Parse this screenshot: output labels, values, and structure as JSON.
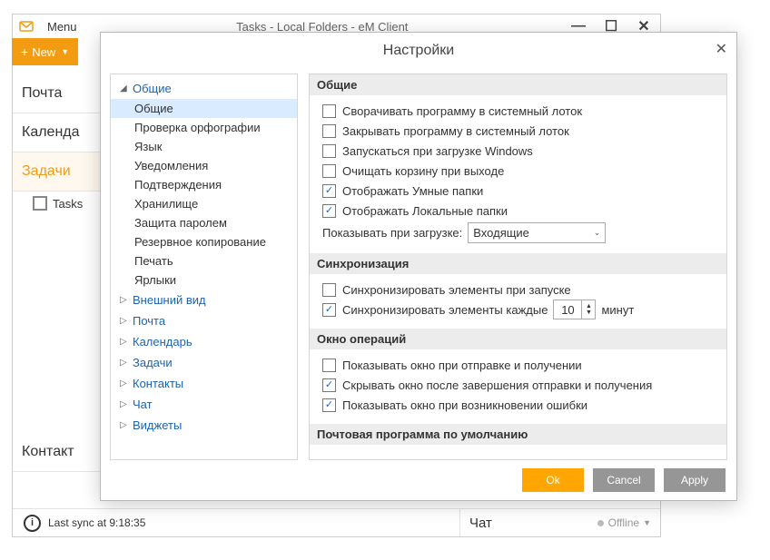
{
  "main": {
    "menu_label": "Menu",
    "title": "Tasks - Local Folders - eM Client",
    "new_button": "New",
    "nav": {
      "mail": "Почта",
      "calendar": "Календа",
      "tasks": "Задачи",
      "contacts": "Контакт",
      "tasks_sub": "Tasks"
    }
  },
  "status": {
    "last_sync": "Last sync at 9:18:35",
    "chat_label": "Чат",
    "offline": "Offline"
  },
  "dialog": {
    "title": "Настройки",
    "tree": {
      "general": "Общие",
      "general_children": {
        "general": "Общие",
        "spellcheck": "Проверка орфографии",
        "language": "Язык",
        "notifications": "Уведомления",
        "confirmations": "Подтверждения",
        "storage": "Хранилище",
        "password": "Защита паролем",
        "backup": "Резервное копирование",
        "print": "Печать",
        "shortcuts": "Ярлыки"
      },
      "appearance": "Внешний вид",
      "mail": "Почта",
      "calendar": "Календарь",
      "tasks": "Задачи",
      "contacts": "Контакты",
      "chat": "Чат",
      "widgets": "Виджеты"
    },
    "sections": {
      "general_header": "Общие",
      "general_opts": {
        "minimize_tray": "Сворачивать программу в системный лоток",
        "close_tray": "Закрывать программу в системный лоток",
        "run_startup": "Запускаться при загрузке Windows",
        "empty_trash": "Очищать корзину при выходе",
        "smart_folders": "Отображать Умные папки",
        "local_folders": "Отображать Локальные папки",
        "show_on_start_label": "Показывать при загрузке:",
        "show_on_start_value": "Входящие"
      },
      "sync_header": "Синхронизация",
      "sync_opts": {
        "sync_startup": "Синхронизировать элементы при запуске",
        "sync_every": "Синхронизировать элементы каждые",
        "sync_minutes_value": "10",
        "sync_minutes_unit": "минут"
      },
      "ops_header": "Окно операций",
      "ops_opts": {
        "show_sendrecv": "Показывать окно при отправке и получении",
        "hide_done": "Скрывать окно после завершения отправки и получения",
        "show_error": "Показывать окно при возникновении ошибки"
      },
      "default_mail_header": "Почтовая программа по умолчанию"
    },
    "buttons": {
      "ok": "Ok",
      "cancel": "Cancel",
      "apply": "Apply"
    }
  }
}
